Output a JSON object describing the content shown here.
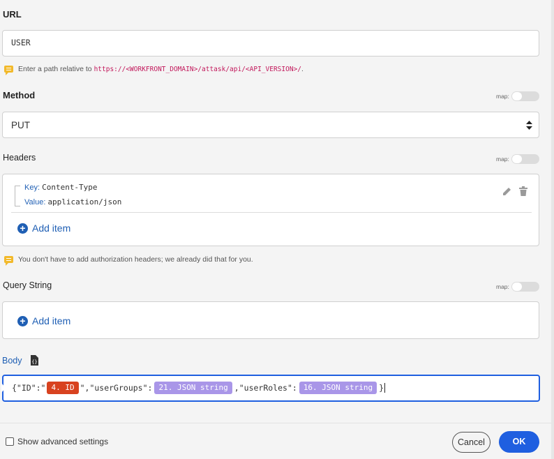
{
  "url": {
    "label": "URL",
    "value": "USER",
    "hint_prefix": "Enter a path relative to ",
    "hint_link": "https://<WORKFRONT_DOMAIN>/attask/api/<API_VERSION>/",
    "hint_suffix": "."
  },
  "method": {
    "label": "Method",
    "value": "PUT",
    "map_label": "map:"
  },
  "headers": {
    "label": "Headers",
    "map_label": "map:",
    "items": [
      {
        "key_label": "Key:",
        "key": "Content-Type",
        "value_label": "Value:",
        "value": "application/json"
      }
    ],
    "add_item": "Add item",
    "hint": "You don't have to add authorization headers; we already did that for you."
  },
  "query_string": {
    "label": "Query String",
    "map_label": "map:",
    "add_item": "Add item"
  },
  "body": {
    "label": "Body",
    "parts": {
      "t1": "{\"ID\":\"",
      "p1": "4. ID",
      "t2": "\",\"userGroups\":",
      "p2": "21. JSON string",
      "t3": ",\"userRoles\":",
      "p3": "16. JSON string",
      "t4": "}"
    }
  },
  "footer": {
    "advanced": "Show advanced settings",
    "cancel": "Cancel",
    "ok": "OK"
  },
  "colors": {
    "pill_id": "#d8421f",
    "pill_json": "#a996e8",
    "ok_button": "#1f5fe0",
    "link": "#c2185b"
  }
}
